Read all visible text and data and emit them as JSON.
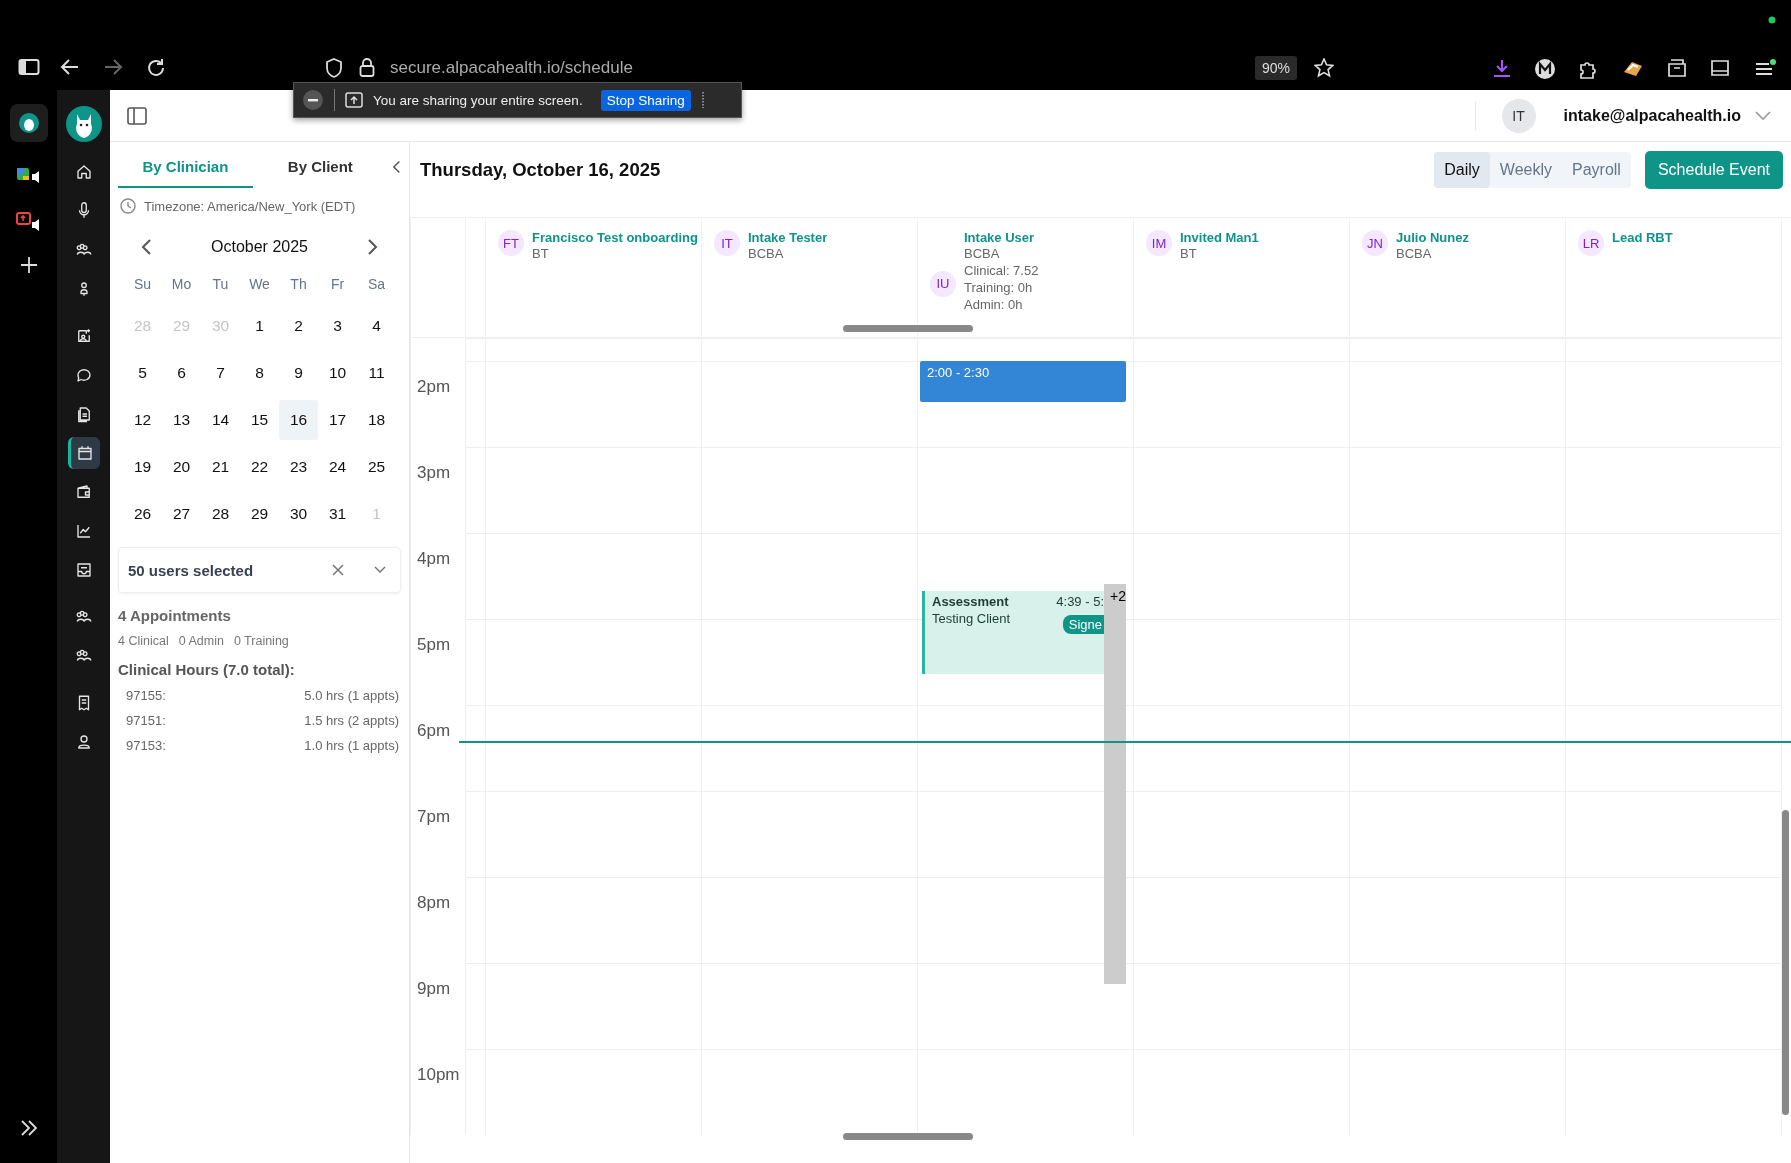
{
  "browser": {
    "url": "secure.alpacahealth.io/schedule",
    "zoom": "90%"
  },
  "share_bar": {
    "message": "You are sharing your entire screen.",
    "button": "Stop Sharing"
  },
  "header": {
    "avatar": "IT",
    "email": "intake@alpacahealth.io"
  },
  "nav": [
    {
      "selected": false
    },
    {
      "selected": false
    },
    {
      "selected": false
    },
    {
      "selected": false
    },
    {
      "selected": false
    },
    {
      "selected": false
    },
    {
      "selected": false
    },
    {
      "selected": true
    },
    {
      "selected": false
    },
    {
      "selected": false
    },
    {
      "selected": false
    },
    {
      "selected": false
    },
    {
      "selected": false
    },
    {
      "selected": false
    },
    {
      "selected": false
    }
  ],
  "panel_tabs": [
    {
      "label": "By Clinician",
      "selected": true
    },
    {
      "label": "By Client",
      "selected": false
    }
  ],
  "timezone": "Timezone: America/New_York (EDT)",
  "calendar": {
    "month": "October 2025",
    "weekdays": [
      "Su",
      "Mo",
      "Tu",
      "We",
      "Th",
      "Fr",
      "Sa"
    ],
    "days": [
      {
        "label": "28",
        "muted": true,
        "selected": false
      },
      {
        "label": "29",
        "muted": true,
        "selected": false
      },
      {
        "label": "30",
        "muted": true,
        "selected": false
      },
      {
        "label": "1",
        "muted": false,
        "selected": false
      },
      {
        "label": "2",
        "muted": false,
        "selected": false
      },
      {
        "label": "3",
        "muted": false,
        "selected": false
      },
      {
        "label": "4",
        "muted": false,
        "selected": false
      },
      {
        "label": "5",
        "muted": false,
        "selected": false
      },
      {
        "label": "6",
        "muted": false,
        "selected": false
      },
      {
        "label": "7",
        "muted": false,
        "selected": false
      },
      {
        "label": "8",
        "muted": false,
        "selected": false
      },
      {
        "label": "9",
        "muted": false,
        "selected": false
      },
      {
        "label": "10",
        "muted": false,
        "selected": false
      },
      {
        "label": "11",
        "muted": false,
        "selected": false
      },
      {
        "label": "12",
        "muted": false,
        "selected": false
      },
      {
        "label": "13",
        "muted": false,
        "selected": false
      },
      {
        "label": "14",
        "muted": false,
        "selected": false
      },
      {
        "label": "15",
        "muted": false,
        "selected": false
      },
      {
        "label": "16",
        "muted": false,
        "selected": true
      },
      {
        "label": "17",
        "muted": false,
        "selected": false
      },
      {
        "label": "18",
        "muted": false,
        "selected": false
      },
      {
        "label": "19",
        "muted": false,
        "selected": false
      },
      {
        "label": "20",
        "muted": false,
        "selected": false
      },
      {
        "label": "21",
        "muted": false,
        "selected": false
      },
      {
        "label": "22",
        "muted": false,
        "selected": false
      },
      {
        "label": "23",
        "muted": false,
        "selected": false
      },
      {
        "label": "24",
        "muted": false,
        "selected": false
      },
      {
        "label": "25",
        "muted": false,
        "selected": false
      },
      {
        "label": "26",
        "muted": false,
        "selected": false
      },
      {
        "label": "27",
        "muted": false,
        "selected": false
      },
      {
        "label": "28",
        "muted": false,
        "selected": false
      },
      {
        "label": "29",
        "muted": false,
        "selected": false
      },
      {
        "label": "30",
        "muted": false,
        "selected": false
      },
      {
        "label": "31",
        "muted": false,
        "selected": false
      },
      {
        "label": "1",
        "muted": true,
        "selected": false
      }
    ]
  },
  "user_filter": {
    "value": "50 users selected"
  },
  "summary": {
    "title": "4 Appointments",
    "counts": [
      "4 Clinical",
      "0 Admin",
      "0 Training"
    ],
    "hours_title": "Clinical Hours (7.0 total):",
    "codes": [
      {
        "code": "97155:",
        "hours": "5.0 hrs (1 appts)"
      },
      {
        "code": "97151:",
        "hours": "1.5 hrs (2 appts)"
      },
      {
        "code": "97153:",
        "hours": "1.0 hrs (1 appts)"
      }
    ]
  },
  "date_title": "Thursday, October 16, 2025",
  "views": [
    {
      "label": "Daily",
      "selected": true
    },
    {
      "label": "Weekly",
      "selected": false
    },
    {
      "label": "Payroll",
      "selected": false
    }
  ],
  "schedule_button": "Schedule Event",
  "clinicians": [
    {
      "initials": "FT",
      "name": "Francisco Test onboarding",
      "details": [
        "BT"
      ]
    },
    {
      "initials": "IT",
      "name": "Intake Tester",
      "details": [
        "BCBA"
      ]
    },
    {
      "initials": "IU",
      "name": "Intake User",
      "details": [
        "BCBA",
        "Clinical: 7.52",
        "Training: 0h",
        "Admin: 0h"
      ],
      "events": [
        {
          "kind": "block",
          "time": "2:00 - 2:30"
        },
        {
          "kind": "appointment",
          "title": "Assessment",
          "client": "Testing Client",
          "time": "4:39 - 5:",
          "badge": "Signe",
          "more": "+2"
        }
      ]
    },
    {
      "initials": "IM",
      "name": "Invited Man1",
      "details": [
        "BT"
      ]
    },
    {
      "initials": "JN",
      "name": "Julio Nunez",
      "details": [
        "BCBA"
      ]
    },
    {
      "initials": "LR",
      "name": "Lead RBT"
    }
  ],
  "hours": [
    {
      "label": "2pm",
      "now": false
    },
    {
      "label": "3pm",
      "now": false
    },
    {
      "label": "4pm",
      "now": false
    },
    {
      "label": "5pm",
      "now": false
    },
    {
      "label": "6pm",
      "now": true
    },
    {
      "label": "7pm",
      "now": false
    },
    {
      "label": "8pm",
      "now": false
    },
    {
      "label": "9pm",
      "now": false
    },
    {
      "label": "10pm",
      "now": false
    }
  ]
}
